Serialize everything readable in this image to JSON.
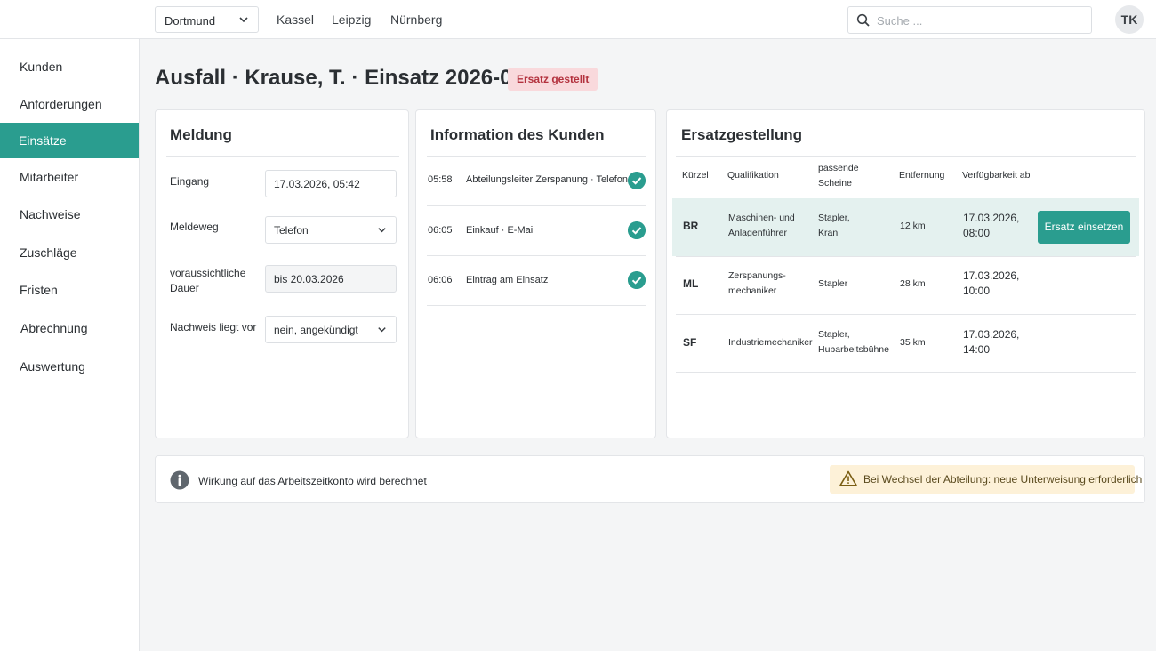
{
  "topbar": {
    "location_select": "Dortmund",
    "links": [
      "Kassel",
      "Leipzig",
      "Nürnberg"
    ],
    "search_placeholder": "Suche ...",
    "avatar_initials": "TK"
  },
  "sidebar": {
    "items": [
      "Kunden",
      "Anforderungen",
      "Einsätze",
      "Mitarbeiter",
      "Nachweise",
      "Zuschläge",
      "Fristen",
      "Abrechnung",
      "Auswertung"
    ],
    "active": "Einsätze"
  },
  "header": {
    "title": "Ausfall",
    "person": "· Krause, T.",
    "assignment": "· Einsatz 2026-0418",
    "status_badge": "Ersatz gestellt"
  },
  "meldung": {
    "title": "Meldung",
    "fields": [
      {
        "label": "Eingang",
        "value": "17.03.2026, 05:42"
      },
      {
        "label": "Meldeweg",
        "value": "Telefon"
      },
      {
        "label": "voraussichtliche Dauer",
        "value": "bis 20.03.2026"
      },
      {
        "label": "Nachweis liegt vor",
        "value": "nein, angekündigt"
      }
    ]
  },
  "kunde": {
    "title": "Information des Kunden",
    "timeline": [
      {
        "time": "05:58",
        "text": "Abteilungsleiter Zerspanung · Telefon"
      },
      {
        "time": "06:05",
        "text": "Einkauf · E-Mail"
      },
      {
        "time": "06:06",
        "text": "Eintrag am Einsatz"
      }
    ]
  },
  "ersatz": {
    "title": "Ersatzgestellung",
    "columns": [
      "Kürzel",
      "Qualifikation",
      "passende Scheine",
      "Entfernung",
      "Verfügbarkeit ab"
    ],
    "rows": [
      {
        "code": "BR",
        "qual": "Maschinen- und Anlagenführer",
        "scheine": "Stapler, Kran",
        "dist": "12 km",
        "avail": "17.03.2026, 08:00"
      },
      {
        "code": "ML",
        "qual": "Zerspanungs- mechaniker",
        "scheine": "Stapler",
        "dist": "28 km",
        "avail": "17.03.2026, 10:00"
      },
      {
        "code": "SF",
        "qual": "Industriemechaniker",
        "scheine": "Stapler, Hubarbeitsbühne",
        "dist": "35 km",
        "avail": "17.03.2026, 14:00"
      }
    ],
    "action_label": "Ersatz einsetzen"
  },
  "infobar": {
    "info_text": "Wirkung auf das Arbeitszeitkonto wird berechnet",
    "warning_text": "Bei Wechsel der Abteilung: neue Unterweisung erforderlich"
  },
  "colors": {
    "accent": "#2a9d8f",
    "badge_bg": "#f9d9dc",
    "badge_text": "#b3323e",
    "warning_bg": "#fdf1d8"
  }
}
